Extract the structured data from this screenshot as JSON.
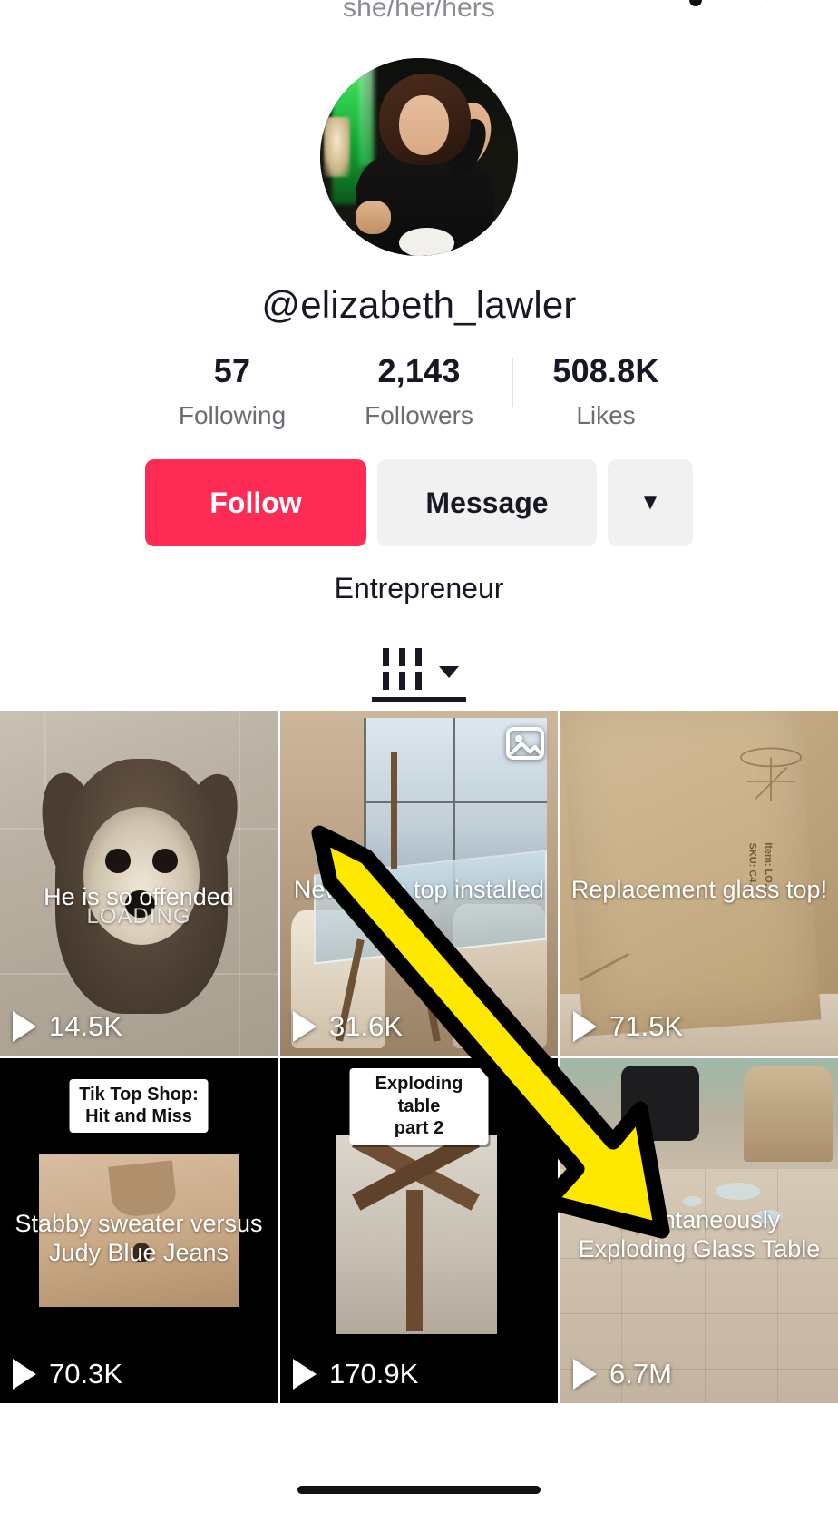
{
  "header": {
    "pronouns": "she/her/hers",
    "back_icon": "back-chevron-icon",
    "notification_icon": "notification-bell-icon",
    "share_icon": "share-arrow-icon"
  },
  "profile": {
    "username": "@elizabeth_lawler",
    "bio": "Entrepreneur",
    "avatar_alt": "profile-photo",
    "stats": [
      {
        "value": "57",
        "label": "Following"
      },
      {
        "value": "2,143",
        "label": "Followers"
      },
      {
        "value": "508.8K",
        "label": "Likes"
      }
    ],
    "buttons": {
      "follow": "Follow",
      "message": "Message",
      "more": "▼"
    }
  },
  "tabs": [
    {
      "id": "videos",
      "icon": "grid-view-icon",
      "active": true,
      "has_caret": true
    }
  ],
  "grid": [
    {
      "id": "video-1",
      "caption": "He is so offended",
      "sub_caption": "LOADING",
      "plays": "14.5K",
      "badge": null,
      "multi_image": false,
      "art": "dog"
    },
    {
      "id": "video-2",
      "caption": "New glass top installed",
      "sub_caption": null,
      "plays": "31.6K",
      "badge": null,
      "multi_image": true,
      "art": "glass-table"
    },
    {
      "id": "video-3",
      "caption": "Replacement glass top!",
      "sub_caption": null,
      "plays": "71.5K",
      "badge": null,
      "multi_image": false,
      "art": "cardboard-box"
    },
    {
      "id": "video-4",
      "caption": "Stabby sweater versus\nJudy Blue Jeans",
      "sub_caption": null,
      "plays": "70.3K",
      "badge": "Tik Top Shop: Hit and Miss",
      "multi_image": false,
      "art": "sweater"
    },
    {
      "id": "video-5",
      "caption": null,
      "sub_caption": null,
      "plays": "170.9K",
      "badge": "Exploding table\npart 2",
      "multi_image": false,
      "art": "table-base"
    },
    {
      "id": "video-6",
      "caption": "Spontaneously\nExploding Glass Table",
      "sub_caption": null,
      "plays": "6.7M",
      "badge": null,
      "multi_image": false,
      "art": "shattered-glass-room"
    }
  ],
  "annotation": {
    "type": "arrow",
    "color": "#FFE800",
    "outline_color": "#000000",
    "points_to": "video-6"
  },
  "colors": {
    "accent_pink": "#FE2C55",
    "button_gray": "#F1F1F2",
    "text_primary": "#161823",
    "text_secondary": "#6B6C74",
    "annotation_yellow": "#FFE800"
  }
}
